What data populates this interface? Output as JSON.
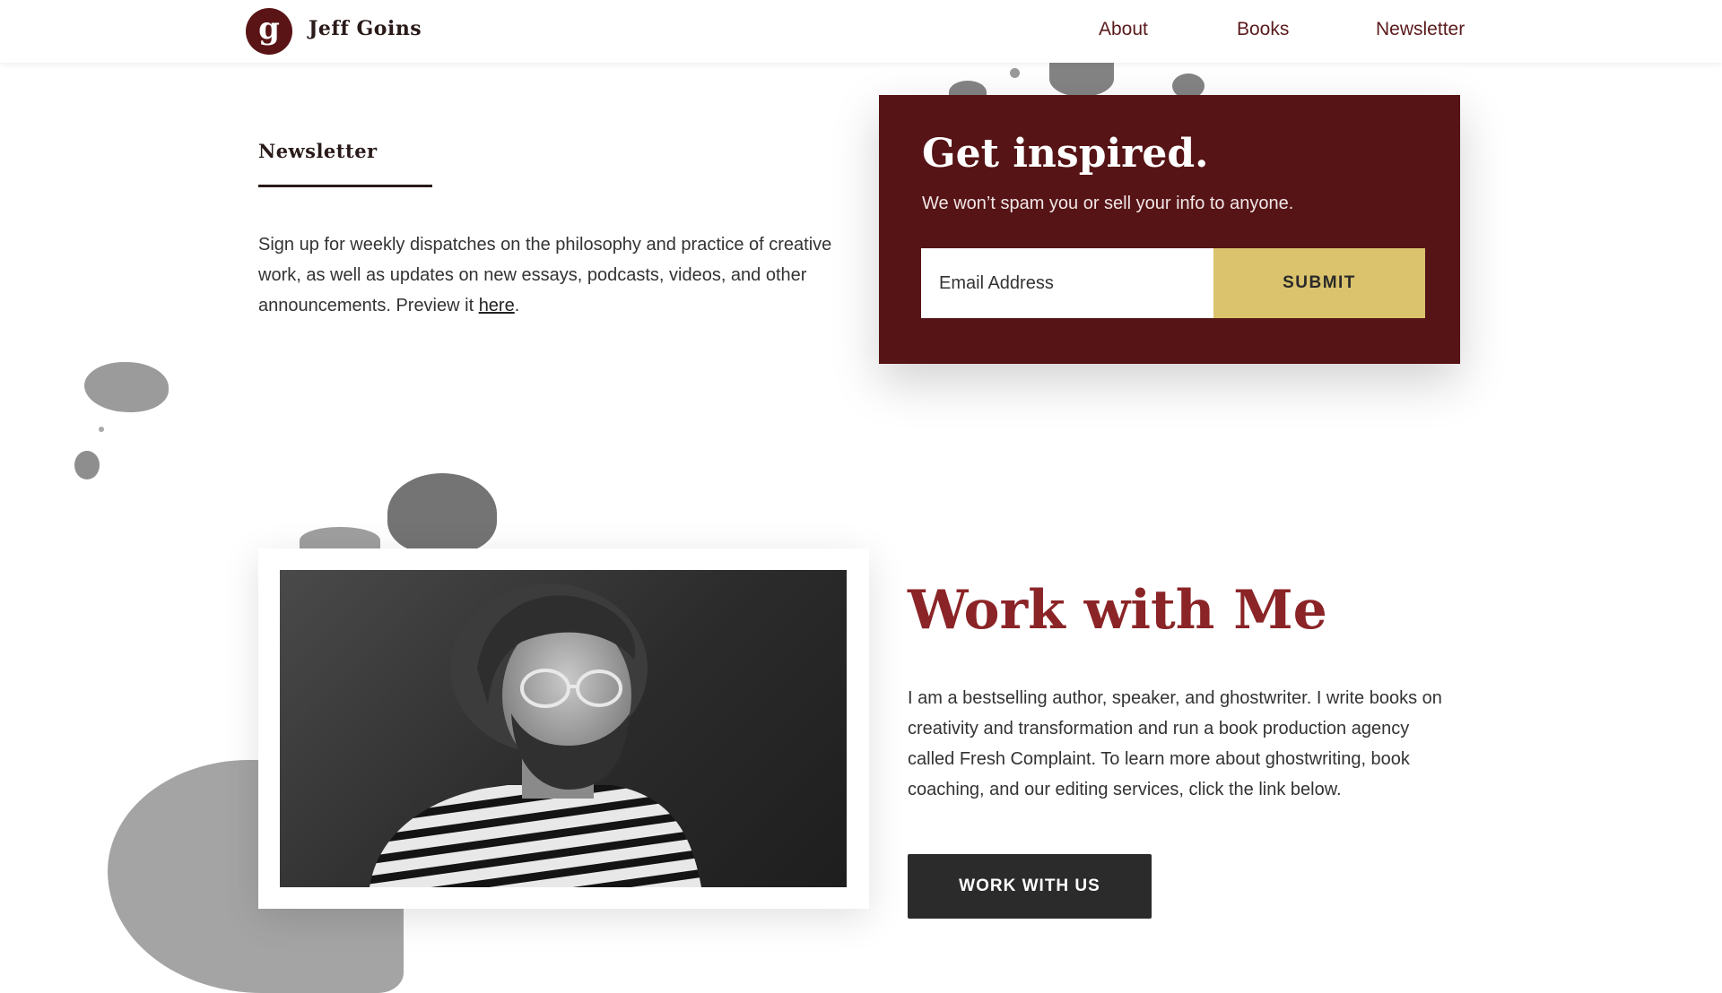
{
  "header": {
    "logo_letter": "g",
    "brand": "Jeff Goins",
    "nav": [
      {
        "label": "About"
      },
      {
        "label": "Books"
      },
      {
        "label": "Newsletter"
      }
    ]
  },
  "newsletter": {
    "label": "Newsletter",
    "text": "Sign up for weekly dispatches on the philosophy and practice of creative work, as well as updates on new essays, podcasts, videos, and other announcements. Preview it ",
    "link": "here",
    "text_end": "."
  },
  "signup": {
    "title": "Get inspired.",
    "subtitle": "We won’t spam you or sell your info to anyone.",
    "email_placeholder": "Email Address",
    "submit_label": "SUBMIT"
  },
  "work": {
    "title": "Work with Me",
    "text": "I am a bestselling author, speaker, and ghostwriter. I write books on creativity and transformation and run a book production agency called Fresh Complaint. To learn more about ghostwriting, book coaching, and our editing services, click the link below.",
    "button_label": "WORK WITH US"
  },
  "colors": {
    "brand_maroon": "#561416",
    "title_red": "#8b2427",
    "submit_gold": "#dac36c",
    "button_dark": "#2b2b2b"
  }
}
